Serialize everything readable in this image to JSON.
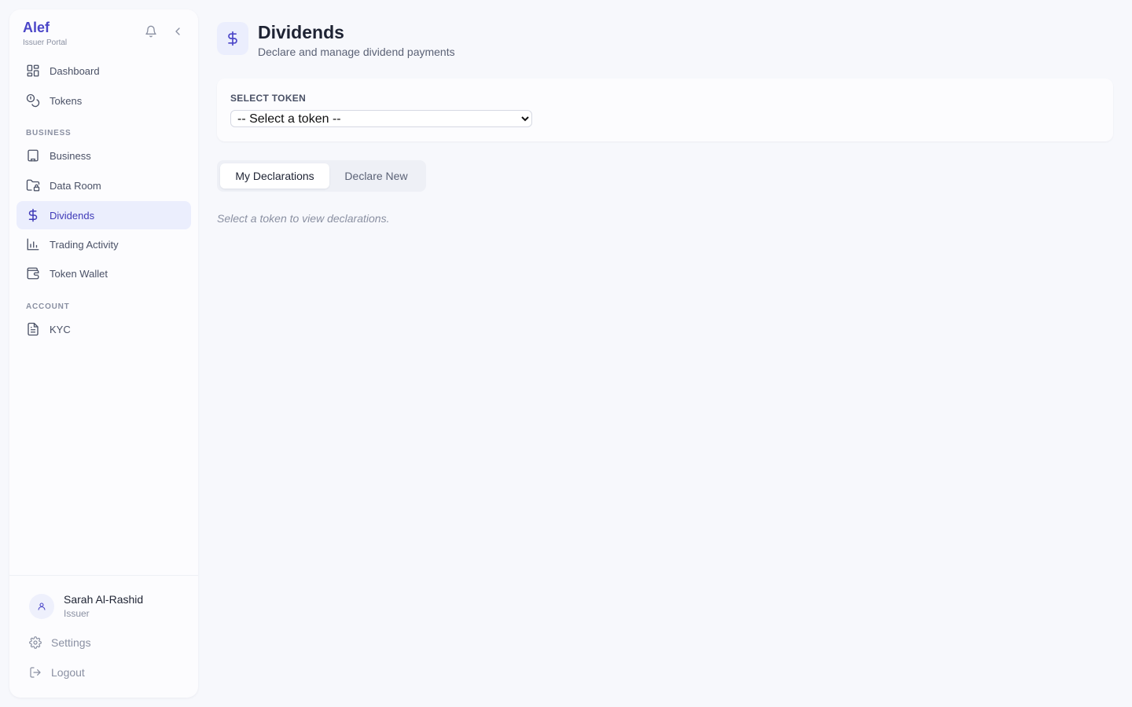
{
  "brand": {
    "name": "Alef",
    "subtitle": "Issuer Portal"
  },
  "sidebar": {
    "top_items": [
      {
        "label": "Dashboard",
        "icon": "grid-icon"
      },
      {
        "label": "Tokens",
        "icon": "coins-icon"
      }
    ],
    "business_label": "BUSINESS",
    "business_items": [
      {
        "label": "Business",
        "icon": "building-icon"
      },
      {
        "label": "Data Room",
        "icon": "folder-lock-icon"
      },
      {
        "label": "Dividends",
        "icon": "dollar-icon",
        "active": true
      },
      {
        "label": "Trading Activity",
        "icon": "bar-chart-icon"
      },
      {
        "label": "Token Wallet",
        "icon": "wallet-icon"
      }
    ],
    "account_label": "ACCOUNT",
    "account_items": [
      {
        "label": "KYC",
        "icon": "document-icon"
      }
    ]
  },
  "user": {
    "name": "Sarah Al-Rashid",
    "role": "Issuer"
  },
  "footer": {
    "settings_label": "Settings",
    "logout_label": "Logout"
  },
  "page": {
    "title": "Dividends",
    "subtitle": "Declare and manage dividend payments"
  },
  "token_select": {
    "label": "SELECT TOKEN",
    "selected": "-- Select a token --"
  },
  "tabs": [
    {
      "label": "My Declarations",
      "active": true
    },
    {
      "label": "Declare New",
      "active": false
    }
  ],
  "empty_message": "Select a token to view declarations.",
  "colors": {
    "accent": "#4b46c8",
    "active_bg": "#ebeefd",
    "page_bg": "#f7f8fc"
  }
}
